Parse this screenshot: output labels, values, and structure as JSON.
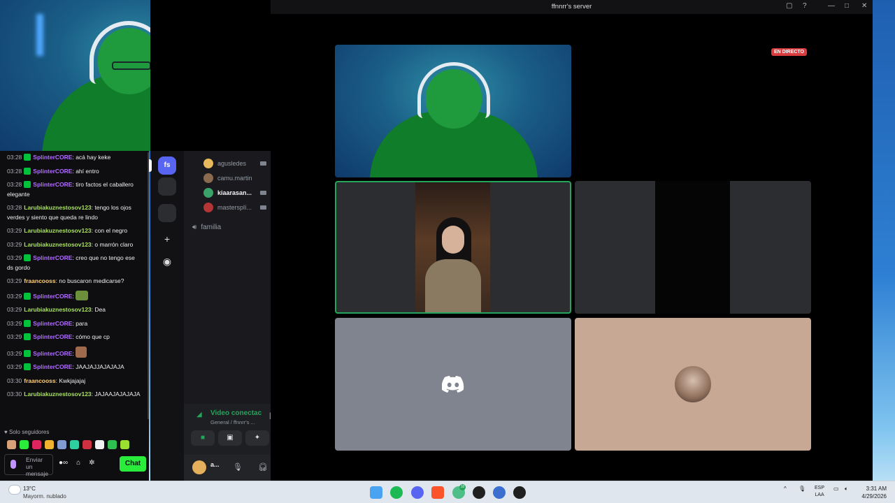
{
  "chat": {
    "messages": [
      {
        "time": "03:28",
        "user": "SplinterCORE",
        "text": ": acá hay keke"
      },
      {
        "time": "03:28",
        "user": "SplinterCORE",
        "text": ": ahí entro"
      },
      {
        "time": "03:28",
        "user": "SplinterCORE",
        "text": ": tiro factos el caballero elegante"
      },
      {
        "time": "03:28",
        "user": "Larubiakuznestosov123",
        "text": ": tengo los ojos verdes y siento que queda re lindo"
      },
      {
        "time": "03:29",
        "user": "Larubiakuznestosov123",
        "text": ": con el negro"
      },
      {
        "time": "03:29",
        "user": "Larubiakuznestosov123",
        "text": ": o marrón claro"
      },
      {
        "time": "03:29",
        "user": "SplinterCORE",
        "text": ": creo que no tengo ese ds gordo"
      },
      {
        "time": "03:29",
        "user": "fraancooss",
        "text": ": no buscaron medicarse?"
      },
      {
        "time": "03:29",
        "user": "SplinterCORE",
        "text": ":"
      },
      {
        "time": "03:29",
        "user": "Larubiakuznestosov123",
        "text": ": Dea"
      },
      {
        "time": "03:29",
        "user": "SplinterCORE",
        "text": ": para"
      },
      {
        "time": "03:29",
        "user": "SplinterCORE",
        "text": ": cómo que cp"
      },
      {
        "time": "03:29",
        "user": "SplinterCORE",
        "text": ":"
      },
      {
        "time": "03:29",
        "user": "SplinterCORE",
        "text": ": JAAJAJJAJAJAJA"
      },
      {
        "time": "03:30",
        "user": "fraancooss",
        "text": ": Kwkjajajaj"
      },
      {
        "time": "03:30",
        "user": "Larubiakuznestosov123",
        "text": ": JAJAAJAJAJAJA"
      }
    ],
    "followers_only": "Solo seguidores",
    "input_placeholder": "Enviar un mensaje",
    "chat_button": "Chat"
  },
  "discord": {
    "window_title": "ffnnrr's server",
    "server_initials": "fs",
    "members": [
      {
        "name": "agusledes",
        "color": "#e7b85c"
      },
      {
        "name": "camu.martin",
        "color": "#8c6a4f"
      },
      {
        "name": "kiaarasan...",
        "color": "#3aa36a"
      },
      {
        "name": "mastersplí...",
        "color": "#b33535"
      }
    ],
    "voice_channel": "familia",
    "voice_status": "Video conectac",
    "voice_sub": "General / ffnnrr's ...",
    "user_name": "a...",
    "live_badge": "EN DIRECTO"
  },
  "taskbar": {
    "temperature": "13°C",
    "weather": "Mayorm. nublado",
    "language": "ESP",
    "language_sub": "LAA",
    "time": "3:31 AM",
    "date": "4/29/2026",
    "badge_count": "10"
  },
  "colors": {
    "twitch_purple": "#b06dff",
    "twitch_green": "#2aec3b",
    "discord_blurple": "#5865f2",
    "discord_green": "#23a55a",
    "live_red": "#d83c3e"
  }
}
